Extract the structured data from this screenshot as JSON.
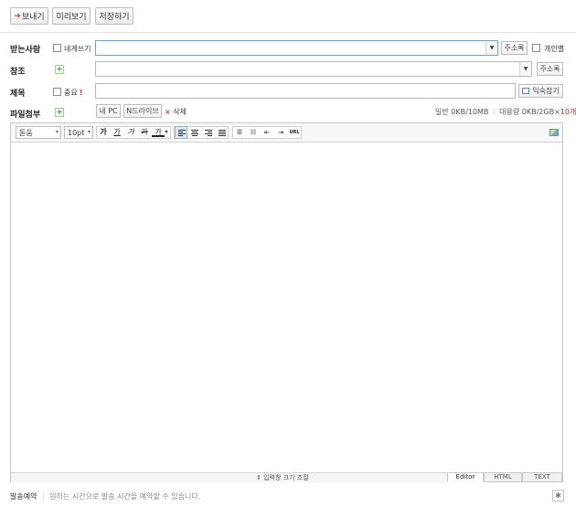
{
  "toolbar": {
    "send_label": "보내기",
    "preview_label": "미리보기",
    "save_label": "저장하기"
  },
  "recipient": {
    "label": "받는사람",
    "self_label": "내게쓰기",
    "value": "",
    "address_book": "주소록",
    "individual_label": "개인별"
  },
  "cc": {
    "label": "참조",
    "value": "",
    "address_book": "주소록"
  },
  "subject": {
    "label": "제목",
    "important_label": "중요",
    "important_mark": "!",
    "value": "",
    "template_button": "익숙잡기"
  },
  "attachment": {
    "label": "파일첨부",
    "mypc_button": "내 PC",
    "ndrive_button": "N드라이브",
    "delete_label": "삭제",
    "size_info": "일반 0KB/10MB",
    "bulk_info_prefix": "대용량 0KB/2GB×",
    "bulk_count": "10개"
  },
  "editor": {
    "font_family": "돋움",
    "font_size": "10pt",
    "format_buttons": [
      "가",
      "가",
      "가",
      "가",
      "가"
    ],
    "link_button": "URL",
    "resize_label": "입력창 크기 조절",
    "modes": [
      "Editor",
      "HTML",
      "TEXT"
    ],
    "active_mode": "Editor"
  },
  "footer": {
    "schedule_label": "발송예약",
    "schedule_hint": "원하는 시간으로 발송 시간을 예약할 수 있습니다."
  },
  "colors": {
    "accent_red": "#e03c20",
    "green": "#3a9a2d",
    "bulk_red": "#d02020"
  }
}
